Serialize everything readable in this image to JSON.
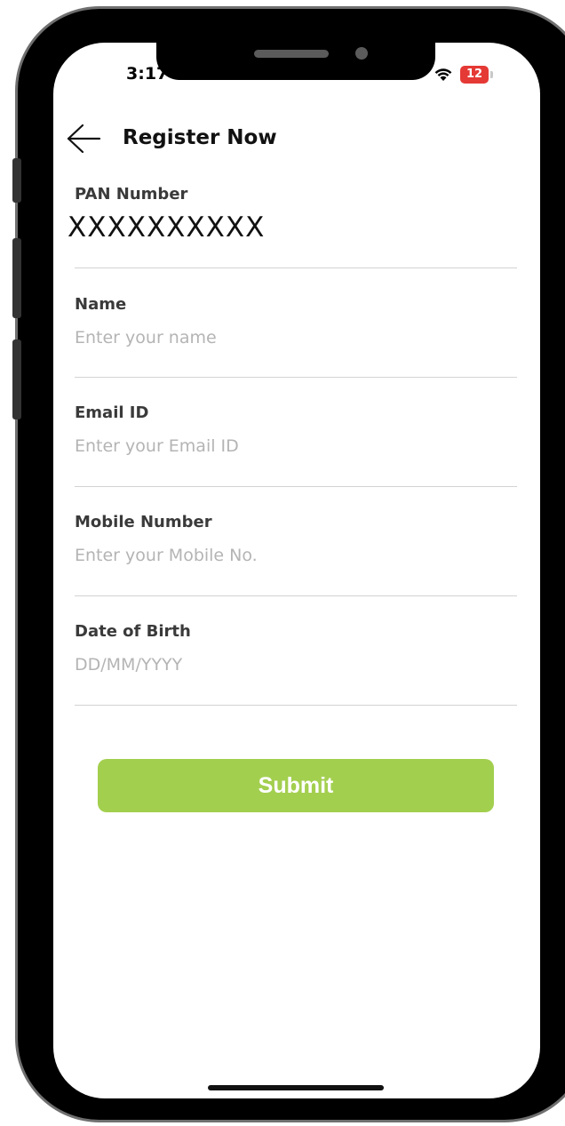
{
  "status_bar": {
    "time": "3:17",
    "battery": "12",
    "wifi_icon": "wifi-icon"
  },
  "header": {
    "back_icon": "arrow-left-icon",
    "title": "Register Now"
  },
  "form": {
    "pan": {
      "label": "PAN Number",
      "value": "XXXXXXXXXX"
    },
    "name": {
      "label": "Name",
      "placeholder": "Enter your name"
    },
    "email": {
      "label": "Email ID",
      "placeholder": "Enter your Email ID"
    },
    "mobile": {
      "label": "Mobile Number",
      "placeholder": "Enter your Mobile No."
    },
    "dob": {
      "label": "Date of Birth",
      "placeholder": "DD/MM/YYYY"
    }
  },
  "submit": {
    "label": "Submit",
    "color": "#a3cf4f"
  },
  "colors": {
    "battery_low": "#e53935",
    "divider": "#d3d3d3",
    "placeholder": "#b4b4b4"
  }
}
